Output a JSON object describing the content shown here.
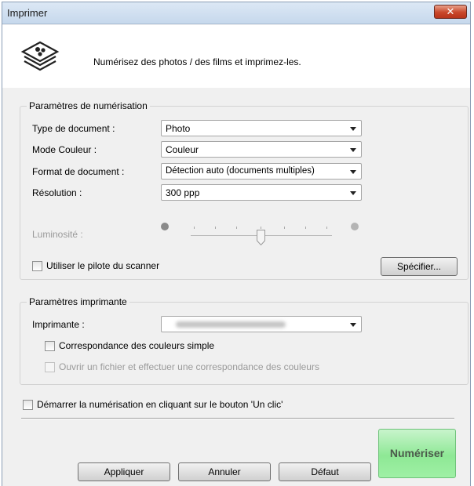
{
  "window": {
    "title": "Imprimer",
    "close_label": "✕"
  },
  "header": {
    "text": "Numérisez des photos / des films et imprimez-les."
  },
  "scan": {
    "group_title": "Paramètres de numérisation",
    "doc_type_label": "Type de document :",
    "doc_type_value": "Photo",
    "color_mode_label": "Mode Couleur :",
    "color_mode_value": "Couleur",
    "doc_format_label": "Format de document :",
    "doc_format_value": "Détection auto (documents multiples)",
    "resolution_label": "Résolution :",
    "resolution_value": "300 ppp",
    "brightness_label": "Luminosité :",
    "brightness_level": 0.5,
    "driver_checkbox_label": "Utiliser le pilote du scanner",
    "specify_button": "Spécifier..."
  },
  "printer": {
    "group_title": "Paramètres imprimante",
    "printer_label": "Imprimante :",
    "simple_color_label": "Correspondance des couleurs simple",
    "open_file_label": "Ouvrir un fichier et effectuer une correspondance des couleurs"
  },
  "one_click_label": "Démarrer la numérisation en cliquant sur le bouton 'Un clic'",
  "buttons": {
    "apply": "Appliquer",
    "cancel": "Annuler",
    "default": "Défaut",
    "scan": "Numériser"
  },
  "colors": {
    "scan_button": "#8ee895",
    "title_bar": "#c6d8ec",
    "close_button": "#c9472a"
  },
  "icons": {
    "header": "scan-photo-icon"
  }
}
